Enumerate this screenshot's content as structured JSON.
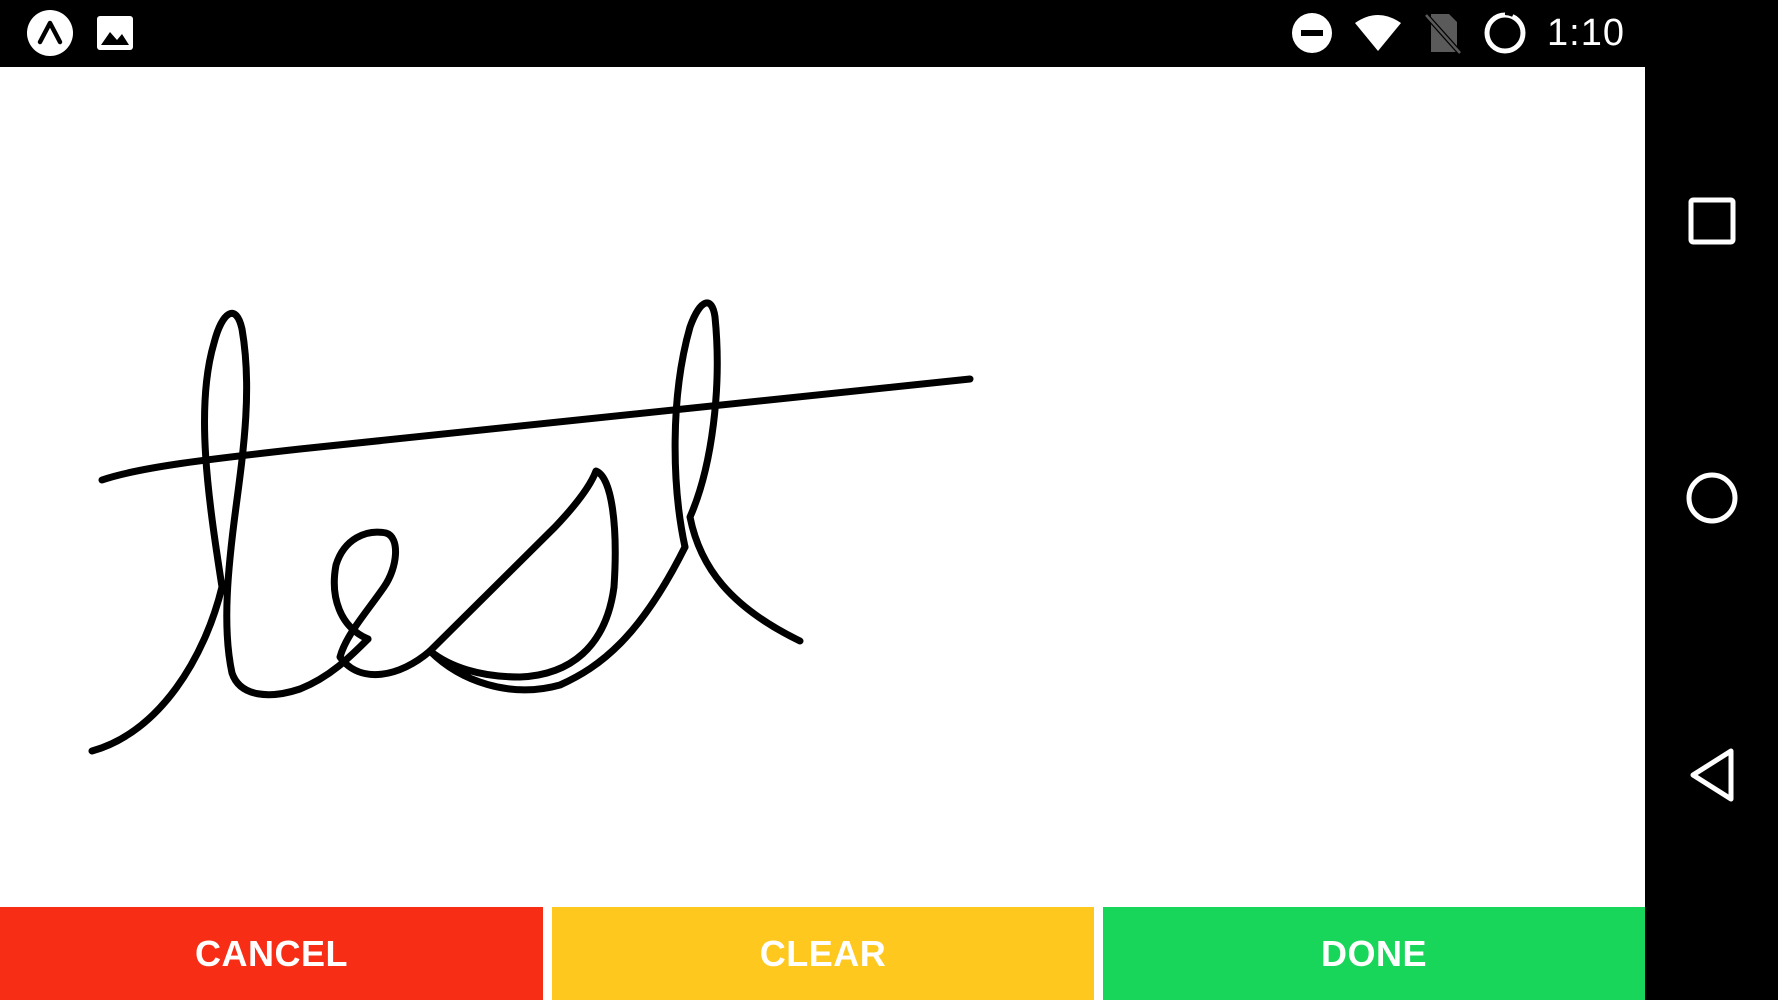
{
  "status_bar": {
    "time": "1:10",
    "left_icons": [
      "app-launcher-icon",
      "image-notification-icon"
    ],
    "right_icons": [
      "do-not-disturb-icon",
      "wifi-icon",
      "no-sim-icon",
      "battery-charging-icon"
    ]
  },
  "canvas": {
    "signature_text": "test"
  },
  "buttons": {
    "cancel": {
      "label": "CANCEL",
      "color": "#f82d16"
    },
    "clear": {
      "label": "CLEAR",
      "color": "#fec81f"
    },
    "done": {
      "label": "DONE",
      "color": "#18d65a"
    }
  },
  "nav_bar": {
    "items": [
      "recents-button",
      "home-button",
      "back-button"
    ]
  }
}
